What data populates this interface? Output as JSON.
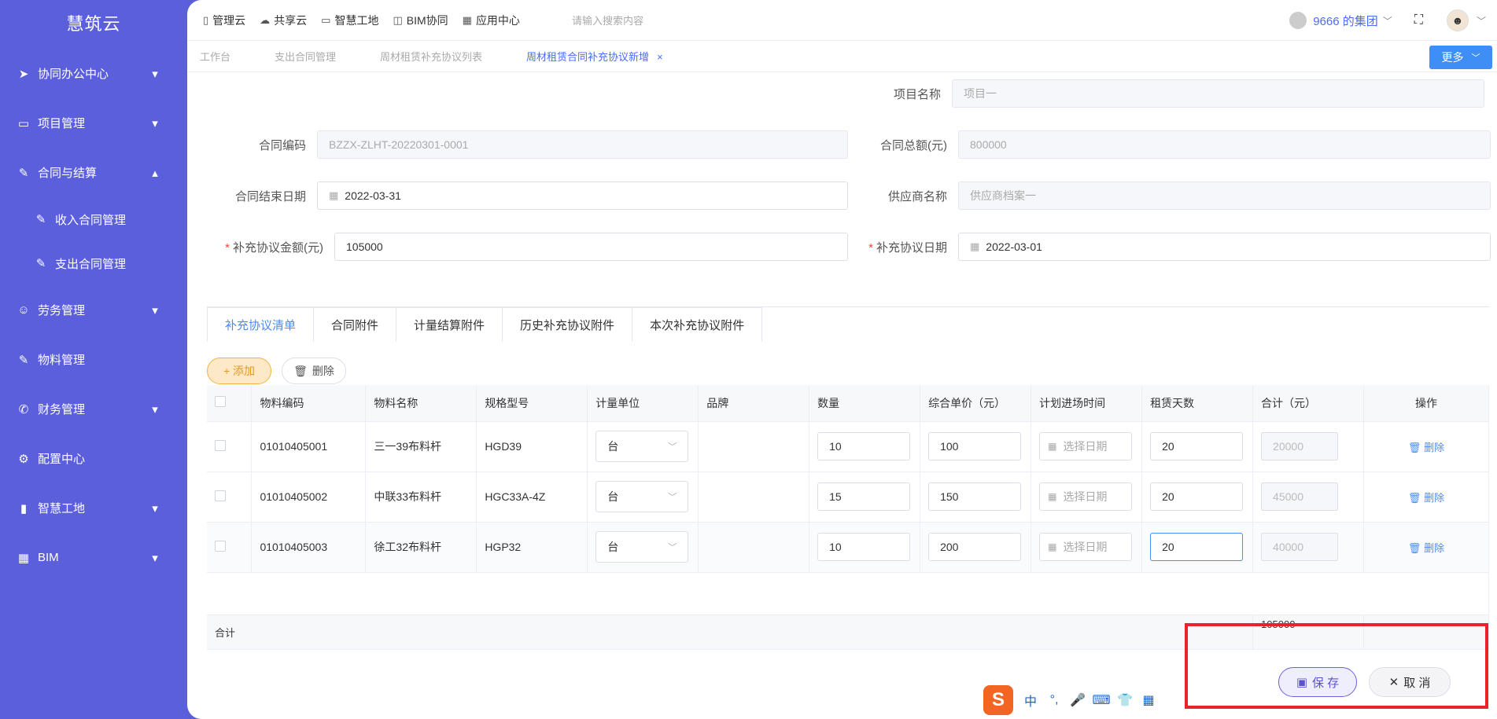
{
  "sidebar": {
    "brand": "慧筑云",
    "items": [
      {
        "label": "协同办公中心",
        "icon": "send-icon",
        "chevron": "▾"
      },
      {
        "label": "项目管理",
        "icon": "book-icon",
        "chevron": "▾"
      },
      {
        "label": "合同与结算",
        "icon": "edit-icon",
        "chevron": "▴"
      },
      {
        "label": "劳务管理",
        "icon": "worker-icon",
        "chevron": "▾"
      },
      {
        "label": "物料管理",
        "icon": "edit-icon",
        "chevron": ""
      },
      {
        "label": "财务管理",
        "icon": "phone-icon",
        "chevron": "▾"
      },
      {
        "label": "配置中心",
        "icon": "gear-icon",
        "chevron": ""
      },
      {
        "label": "智慧工地",
        "icon": "bar-chart-icon",
        "chevron": "▾"
      },
      {
        "label": "BIM",
        "icon": "grid-icon",
        "chevron": "▾"
      }
    ],
    "sub_items": [
      {
        "label": "收入合同管理"
      },
      {
        "label": "支出合同管理"
      }
    ]
  },
  "topbar": {
    "nav": [
      {
        "label": "管理云"
      },
      {
        "label": "共享云"
      },
      {
        "label": "智慧工地"
      },
      {
        "label": "BIM协同"
      },
      {
        "label": "应用中心"
      }
    ],
    "search_placeholder": "请输入搜索内容",
    "org": "9666 的集团"
  },
  "tabs": [
    {
      "label": "工作台"
    },
    {
      "label": "支出合同管理"
    },
    {
      "label": "周材租赁补充协议列表"
    },
    {
      "label": "周材租赁合同补充协议新增"
    }
  ],
  "more_label": "更多",
  "form": {
    "project_name_label": "项目名称",
    "project_name_value": "项目一",
    "contract_code_label": "合同编码",
    "contract_code_value": "BZZX-ZLHT-20220301-0001",
    "contract_total_label": "合同总额(元)",
    "contract_total_value": "800000",
    "end_date_label": "合同结束日期",
    "end_date_value": "2022-03-31",
    "supplier_label": "供应商名称",
    "supplier_value": "供应商档案一",
    "supp_amount_label": "补充协议金额(元)",
    "supp_amount_value": "105000",
    "supp_date_label": "补充协议日期",
    "supp_date_value": "2022-03-01"
  },
  "detail_tabs": [
    {
      "label": "补充协议清单"
    },
    {
      "label": "合同附件"
    },
    {
      "label": "计量结算附件"
    },
    {
      "label": "历史补充协议附件"
    },
    {
      "label": "本次补充协议附件"
    }
  ],
  "toolbar": {
    "add_label": "+ 添加",
    "delete_label": "删除"
  },
  "table": {
    "headers": [
      "物料编码",
      "物料名称",
      "规格型号",
      "计量单位",
      "品牌",
      "数量",
      "综合单价（元）",
      "计划进场时间",
      "租赁天数",
      "合计（元）",
      "操作"
    ],
    "rows": [
      {
        "code": "01010405001",
        "name": "三一39布料杆",
        "spec": "HGD39",
        "unit": "台",
        "brand": "",
        "qty": "10",
        "price": "100",
        "date_ph": "选择日期",
        "days": "20",
        "total": "20000",
        "op": "删除"
      },
      {
        "code": "01010405002",
        "name": "中联33布料杆",
        "spec": "HGC33A-4Z",
        "unit": "台",
        "brand": "",
        "qty": "15",
        "price": "150",
        "date_ph": "选择日期",
        "days": "20",
        "total": "45000",
        "op": "删除"
      },
      {
        "code": "01010405003",
        "name": "徐工32布料杆",
        "spec": "HGP32",
        "unit": "台",
        "brand": "",
        "qty": "10",
        "price": "200",
        "date_ph": "选择日期",
        "days": "20",
        "total": "40000",
        "op": "删除"
      }
    ],
    "sum_label": "合计",
    "sum_total": "105000"
  },
  "actions": {
    "save_label": "保 存",
    "cancel_label": "取 消"
  },
  "ime": {
    "logo": "S",
    "items": [
      "中",
      "°,",
      "🎤",
      "⌨",
      "👕",
      "▦"
    ]
  },
  "colors": {
    "sidebar": "#5b5fdc",
    "accent": "#4a8cf5",
    "highlight": "#e5252a",
    "add": "#f5b041"
  }
}
